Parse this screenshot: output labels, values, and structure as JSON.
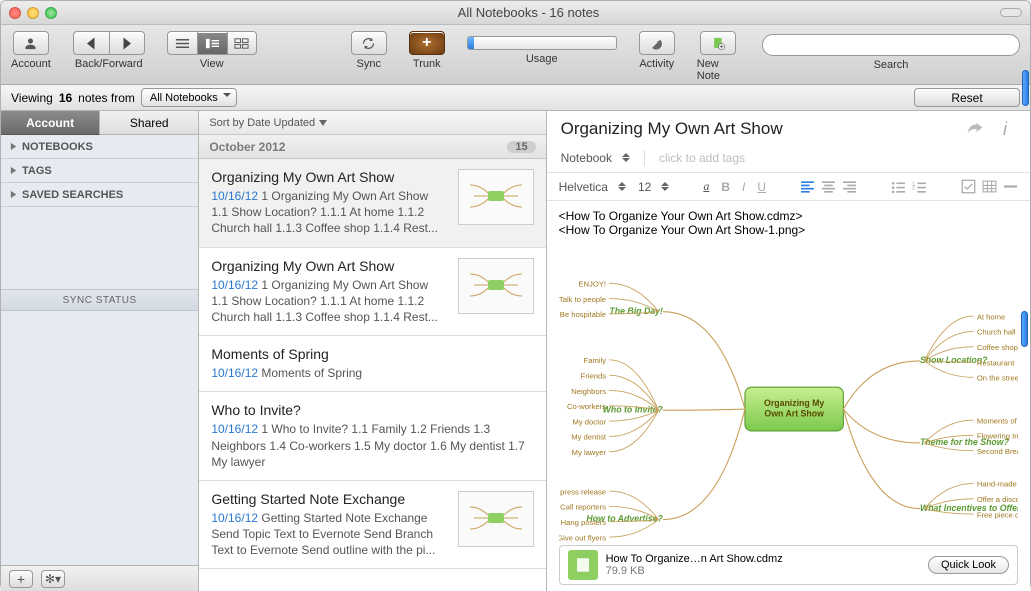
{
  "window": {
    "title": "All Notebooks - 16 notes"
  },
  "toolbar": {
    "account": "Account",
    "backforward": "Back/Forward",
    "view": "View",
    "sync": "Sync",
    "trunk": "Trunk",
    "usage": "Usage",
    "activity": "Activity",
    "newnote": "New Note",
    "search": "Search"
  },
  "filter": {
    "viewing_pre": "Viewing ",
    "count": "16",
    "viewing_post": " notes from",
    "scope": "All Notebooks",
    "reset": "Reset"
  },
  "sidebar": {
    "tabs": {
      "account": "Account",
      "shared": "Shared"
    },
    "sections": [
      "NOTEBOOKS",
      "TAGS",
      "SAVED SEARCHES"
    ],
    "sync_status": "SYNC STATUS"
  },
  "notelist": {
    "sort_label": "Sort by Date Updated",
    "month": "October 2012",
    "month_count": "15",
    "items": [
      {
        "title": "Organizing My Own Art Show",
        "date": "10/16/12",
        "snippet": "1 Organizing My Own Art Show 1.1 Show Location? 1.1.1 At home 1.1.2 Church hall 1.1.3 Coffee shop 1.1.4 Rest...",
        "thumb": true
      },
      {
        "title": "Organizing My Own Art Show",
        "date": "10/16/12",
        "snippet": "1 Organizing My Own Art Show 1.1 Show Location? 1.1.1 At home 1.1.2 Church hall 1.1.3 Coffee shop 1.1.4 Rest...",
        "thumb": true
      },
      {
        "title": "Moments of Spring",
        "date": "10/16/12",
        "snippet": "Moments of Spring",
        "thumb": false
      },
      {
        "title": "Who to Invite?",
        "date": "10/16/12",
        "snippet": "1 Who to Invite? 1.1 Family 1.2 Friends 1.3 Neighbors 1.4 Co-workers 1.5 My doctor 1.6 My dentist 1.7 My lawyer",
        "thumb": false
      },
      {
        "title": "Getting Started Note Exchange",
        "date": "10/16/12",
        "snippet": "Getting Started Note Exchange Send Topic Text to Evernote Send Branch Text to Evernote Send outline with the pi...",
        "thumb": true
      }
    ]
  },
  "detail": {
    "title": "Organizing My Own Art Show",
    "notebook_label": "Notebook",
    "tags_placeholder": "click to add tags",
    "font": "Helvetica",
    "size": "12",
    "body_lines": [
      "<How To Organize Your Own Art Show.cdmz>",
      "<How To Organize Your Own Art Show-1.png>"
    ],
    "mindmap": {
      "center": "Organizing My Own Art Show",
      "branches": {
        "big_day": {
          "title": "The Big Day!",
          "items": [
            "ENJOY!",
            "Talk to people",
            "Be hospitable"
          ]
        },
        "invite": {
          "title": "Who to Invite?",
          "items": [
            "Family",
            "Friends",
            "Neighbors",
            "Co-workers",
            "My doctor",
            "My dentist",
            "My lawyer"
          ]
        },
        "advert": {
          "title": "How to Advertise?",
          "items": [
            "Send a press release",
            "Call reporters",
            "Hang posters",
            "Give out flyers"
          ]
        },
        "location": {
          "title": "Show Location?",
          "items": [
            "At home",
            "Church hall",
            "Coffee shop",
            "Restaurant",
            "On the street"
          ]
        },
        "theme": {
          "title": "Theme for the Show?",
          "items": [
            "Moments of Spring",
            "Flowering Inspiration",
            "Second Breath"
          ]
        },
        "incent": {
          "title": "What Incentives to Offer?",
          "items": [
            "Hand-made postcards",
            "Offer a discount!",
            "Free piece of art"
          ]
        }
      }
    },
    "attachment": {
      "name": "How To Organize…n Art Show.cdmz",
      "size": "79.9 KB",
      "quicklook": "Quick Look"
    }
  }
}
